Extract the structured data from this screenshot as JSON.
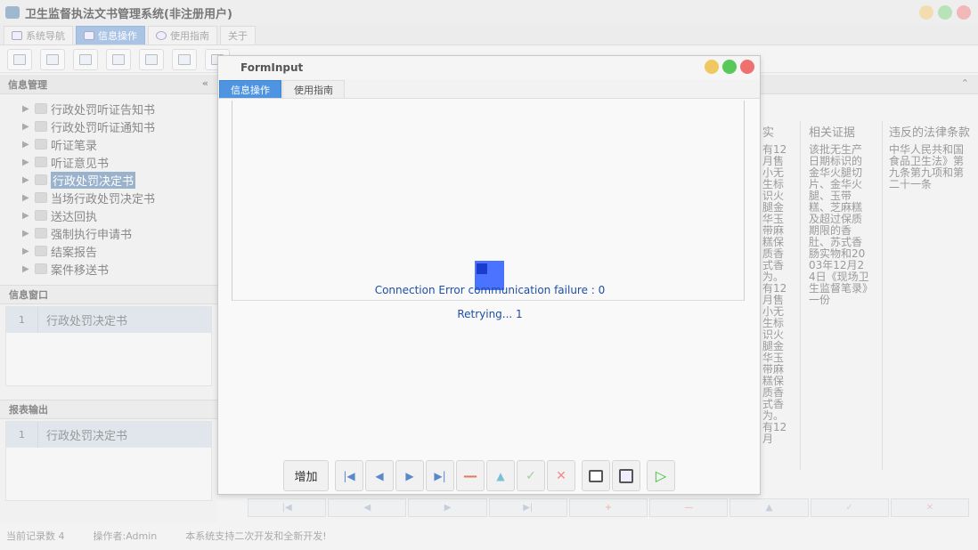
{
  "app": {
    "title": "卫生监督执法文书管理系统(非注册用户)",
    "menu": [
      {
        "label": "系统导航"
      },
      {
        "label": "信息操作"
      },
      {
        "label": "使用指南"
      },
      {
        "label": "关于"
      }
    ]
  },
  "left": {
    "info_manage_title": "信息管理",
    "collapse_glyph": "«",
    "tree": [
      {
        "label": "行政处罚听证告知书"
      },
      {
        "label": "行政处罚听证通知书"
      },
      {
        "label": "听证笔录"
      },
      {
        "label": "听证意见书"
      },
      {
        "label": "行政处罚决定书"
      },
      {
        "label": "当场行政处罚决定书"
      },
      {
        "label": "送达回执"
      },
      {
        "label": "强制执行申请书"
      },
      {
        "label": "结案报告"
      },
      {
        "label": "案件移送书"
      }
    ],
    "info_window_title": "信息窗口",
    "info_window_row": {
      "num": "1",
      "value": "行政处罚决定书"
    },
    "report_title": "报表输出",
    "report_row": {
      "num": "1",
      "value": "行政处罚决定书"
    }
  },
  "right": {
    "col1_head": "实",
    "col2_head": "相关证据",
    "col3_head": "违反的法律条款",
    "col1_body": "有12月售小无生标识火腿金华玉带麻糕保质香式香为。有12月售小无生标识火腿金华玉带麻糕保质香式香为。有12月",
    "col2_body": "该批无生产日期标识的金华火腿切片、金华火腿、玉带糕、芝麻糕及超过保质期限的香肚、苏式香肠实物和2003年12月24日《现场卫生监督笔录》一份",
    "col3_body": "中华人民共和国食品卫生法》第九条第九项和第二十一条",
    "up_glyph": "⌃"
  },
  "status": {
    "record_count": "当前记录数 4",
    "operator": "操作者:Admin",
    "note": "本系统支持二次开发和全新开发!"
  },
  "dialog": {
    "title": "FormInput",
    "tabs": [
      {
        "label": "信息操作"
      },
      {
        "label": "使用指南"
      }
    ],
    "error": "Connection Error communication failure : 0",
    "retry": "Retrying... 1",
    "add_label": "增加",
    "first_glyph": "|◀",
    "prev_glyph": "◀",
    "next_glyph": "▶",
    "last_glyph": "▶|",
    "minus_glyph": "—",
    "up_glyph": "▲",
    "check_glyph": "✓",
    "cancel_glyph": "✕",
    "play_glyph": "▷"
  },
  "bottom_nav": [
    "|◀",
    "◀",
    "▶",
    "▶|",
    "+",
    "—",
    "▲",
    "✓",
    "✕"
  ],
  "colors": {
    "accent": "#4f94e0",
    "close": "#f07070",
    "max": "#58c858",
    "min": "#f0c860",
    "spinner": "#4a73ff"
  }
}
